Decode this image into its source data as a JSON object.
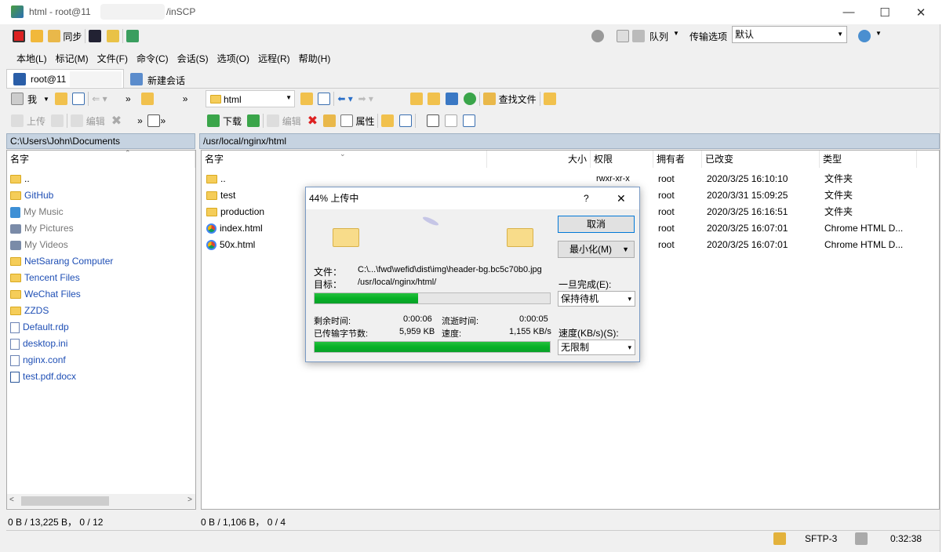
{
  "window": {
    "title": "html - root@11",
    "title_suffix": "/inSCP",
    "minimize": "—",
    "maximize": "☐",
    "close": "✕"
  },
  "toolbar": {
    "sync": "同步",
    "queue": "队列",
    "transfer_options": "传输选项",
    "transfer_preset": "默认"
  },
  "menu": [
    "本地(L)",
    "标记(M)",
    "文件(F)",
    "命令(C)",
    "会话(S)",
    "选项(O)",
    "远程(R)",
    "帮助(H)"
  ],
  "tabs": {
    "session": "root@11",
    "new_session": "新建会话"
  },
  "left": {
    "drive": "我",
    "upload": "上传",
    "edit": "编辑",
    "path": "C:\\Users\\John\\Documents",
    "col_name": "名字",
    "items": [
      {
        "name": "..",
        "type": "up"
      },
      {
        "name": "GitHub",
        "type": "folder"
      },
      {
        "name": "My Music",
        "type": "music"
      },
      {
        "name": "My Pictures",
        "type": "pic"
      },
      {
        "name": "My Videos",
        "type": "video"
      },
      {
        "name": "NetSarang Computer",
        "type": "folder"
      },
      {
        "name": "Tencent Files",
        "type": "folder"
      },
      {
        "name": "WeChat Files",
        "type": "folder"
      },
      {
        "name": "ZZDS",
        "type": "folder"
      },
      {
        "name": "Default.rdp",
        "type": "file"
      },
      {
        "name": "desktop.ini",
        "type": "file"
      },
      {
        "name": "nginx.conf",
        "type": "file"
      },
      {
        "name": "test.pdf.docx",
        "type": "doc"
      }
    ],
    "status": "0 B / 13,225 B， 0 / 12"
  },
  "right": {
    "dir": "html",
    "find": "查找文件",
    "download": "下载",
    "edit": "编辑",
    "properties": "属性",
    "path": "/usr/local/nginx/html",
    "cols": {
      "name": "名字",
      "size": "大小",
      "rights": "权限",
      "owner": "拥有者",
      "changed": "已改变",
      "type": "类型"
    },
    "items": [
      {
        "name": "..",
        "rights": "rwxr-xr-x",
        "owner": "root",
        "changed": "2020/3/25 16:10:10",
        "type": "文件夹",
        "kind": "up"
      },
      {
        "name": "test",
        "rights": "",
        "owner": "root",
        "changed": "2020/3/31 15:09:25",
        "type": "文件夹",
        "kind": "folder"
      },
      {
        "name": "production",
        "rights": "",
        "owner": "root",
        "changed": "2020/3/25 16:16:51",
        "type": "文件夹",
        "kind": "folder"
      },
      {
        "name": "index.html",
        "rights": "",
        "owner": "root",
        "changed": "2020/3/25 16:07:01",
        "type": "Chrome HTML D...",
        "kind": "chrome"
      },
      {
        "name": "50x.html",
        "rights": "",
        "owner": "root",
        "changed": "2020/3/25 16:07:01",
        "type": "Chrome HTML D...",
        "kind": "chrome"
      }
    ],
    "status": "0 B / 1,106 B， 0 / 4"
  },
  "bottom": {
    "protocol": "SFTP-3",
    "time": "0:32:38"
  },
  "dialog": {
    "title": "44% 上传中",
    "help": "?",
    "close": "✕",
    "cancel": "取消",
    "minimize": "最小化(M)",
    "file_label": "文件：",
    "file": "C:\\...\\fwd\\wefid\\dist\\img\\header-bg.bc5c70b0.jpg",
    "target_label": "目标：",
    "target": "/usr/local/nginx/html/",
    "once_done": "一旦完成(E):",
    "once_done_value": "保持待机",
    "remaining_label": "剩余时间:",
    "remaining": "0:00:06",
    "elapsed_label": "流逝时间:",
    "elapsed": "0:00:05",
    "bytes_label": "已传输字节数:",
    "bytes": "5,959 KB",
    "speed_label": "速度:",
    "speed": "1,155 KB/s",
    "limit_label": "速度(KB/s)(S):",
    "limit_value": "无限制",
    "file_progress": 0.44,
    "total_progress": 1.0
  }
}
